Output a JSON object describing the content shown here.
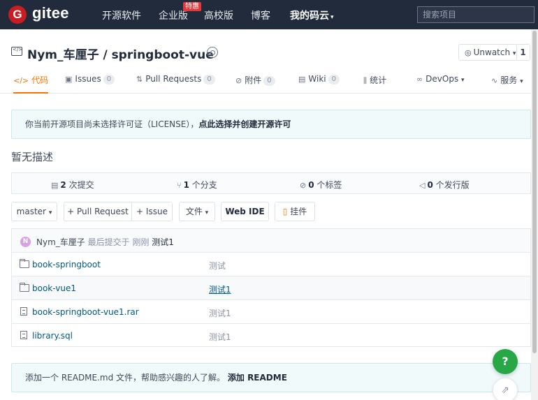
{
  "nav": {
    "logo_letter": "G",
    "logo_text": "gitee",
    "items": [
      "开源软件",
      "企业版",
      "高校版",
      "博客",
      "我的码云"
    ],
    "enterprise_badge": "特惠",
    "my_caret": "▾",
    "search_placeholder": "搜索项目"
  },
  "repo": {
    "title": "Nym_车厘子 / springboot-vue",
    "watch_label": "Unwatch",
    "watch_caret": "▾",
    "watch_count": "1"
  },
  "tabs": [
    {
      "label": "代码",
      "icon": "code-icon",
      "glyph": "</>"
    },
    {
      "label": "Issues",
      "count": "0",
      "icon": "issue-icon",
      "glyph": "▣"
    },
    {
      "label": "Pull Requests",
      "count": "0",
      "icon": "pull-request-icon",
      "glyph": "⇅"
    },
    {
      "label": "附件",
      "count": "0",
      "icon": "attachment-icon",
      "glyph": "⊘"
    },
    {
      "label": "Wiki",
      "count": "0",
      "icon": "wiki-icon",
      "glyph": "▤"
    },
    {
      "label": "统计",
      "icon": "stats-icon",
      "glyph": "⫼"
    },
    {
      "label": "DevOps",
      "icon": "devops-icon",
      "glyph": "∞",
      "caret": "▾"
    },
    {
      "label": "服务",
      "icon": "service-icon",
      "glyph": "∿",
      "caret": "▾"
    }
  ],
  "license_notice": {
    "text": "你当前开源项目尚未选择许可证（LICENSE），",
    "link": "点此选择并创建开源许可"
  },
  "description": "暂无描述",
  "stats": {
    "commits_count": "2",
    "commits_label": "次提交",
    "branches_count": "1",
    "branches_label": "个分支",
    "tags_count": "0",
    "tags_label": "个标签",
    "releases_count": "0",
    "releases_label": "个发行版"
  },
  "actions": {
    "branch": "master",
    "branch_caret": "▾",
    "pull_request": "+ Pull Request",
    "issue": "+ Issue",
    "file": "文件",
    "file_caret": "▾",
    "webide": "Web IDE",
    "widget": "挂件"
  },
  "last_commit": {
    "avatar_letter": "N",
    "author": "Nym_车厘子",
    "meta": "最后提交于",
    "time": "刚刚",
    "message": "测试1"
  },
  "files": [
    {
      "name": "book-springboot",
      "type": "folder",
      "message": "测试"
    },
    {
      "name": "book-vue1",
      "type": "folder",
      "message": "测试1"
    },
    {
      "name": "book-springboot-vue1.rar",
      "type": "file",
      "message": "测试1"
    },
    {
      "name": "library.sql",
      "type": "file",
      "message": "测试1"
    }
  ],
  "readme": {
    "text": "添加一个 README.md 文件，帮助感兴趣的人了解。",
    "link": "添加 README"
  },
  "floating": {
    "help": "?",
    "feedback": "⇗"
  },
  "colors": {
    "nav_bg": "#212b3c",
    "logo_red": "#c71d23",
    "accent_orange": "#fe7300",
    "help_green": "#27a746",
    "link_blue": "#005980"
  }
}
